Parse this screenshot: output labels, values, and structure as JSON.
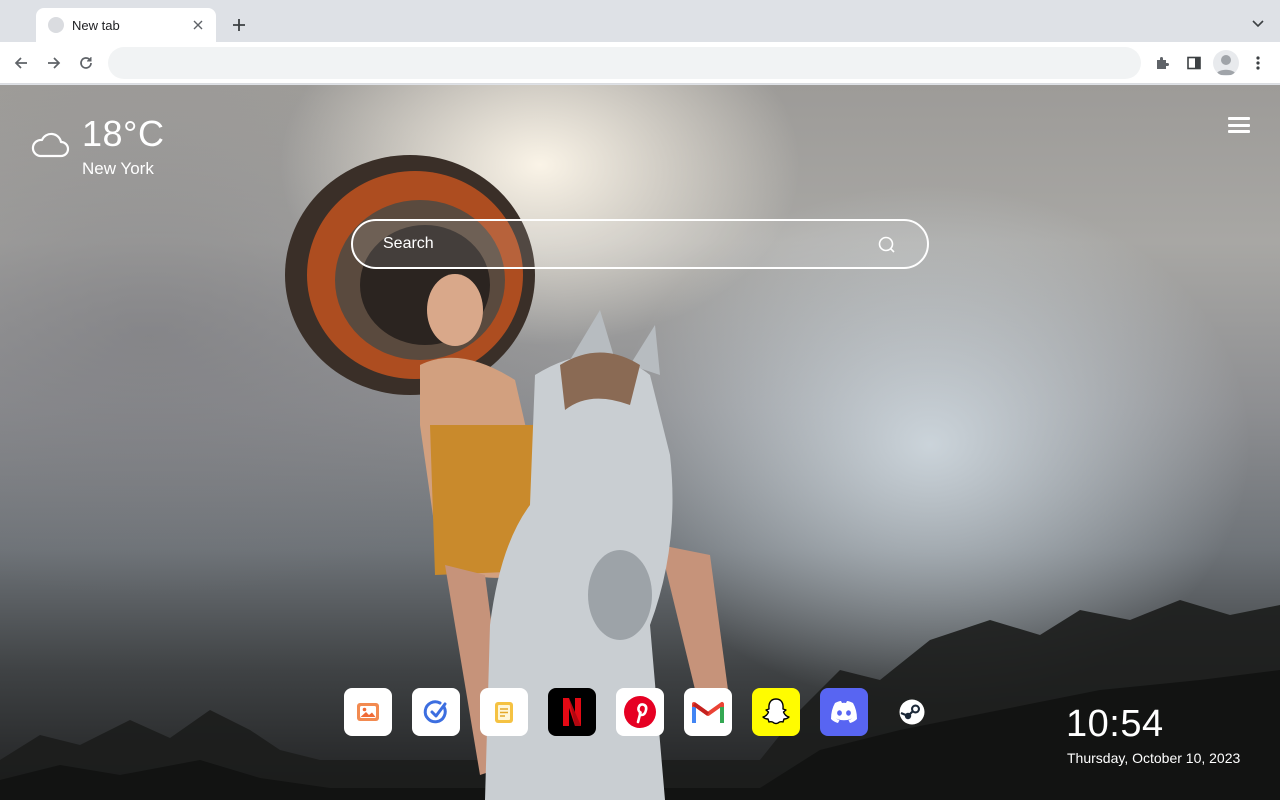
{
  "browser": {
    "tab_title": "New tab",
    "omnibox_value": "",
    "icons": [
      "tab-favicon-icon",
      "close-icon",
      "plus-icon",
      "chevron-down-icon",
      "back-arrow-icon",
      "forward-arrow-icon",
      "reload-icon",
      "puzzle-extension-icon",
      "side-panel-icon",
      "profile-avatar-icon",
      "kebab-menu-icon"
    ]
  },
  "weather": {
    "temperature": "18°C",
    "city": "New York",
    "icon": "cloud-icon"
  },
  "search": {
    "placeholder": "Search",
    "icon": "search-icon"
  },
  "menu": {
    "icon": "hamburger-menu-icon"
  },
  "shortcuts": [
    {
      "name": "Photos",
      "icon": "image-icon",
      "bg": "#ffffff",
      "accent": "#f06a35"
    },
    {
      "name": "Todo",
      "icon": "check-circle-icon",
      "bg": "#ffffff",
      "accent": "#3c6ee0"
    },
    {
      "name": "Notes",
      "icon": "note-icon",
      "bg": "#ffffff",
      "accent": "#f5c242"
    },
    {
      "name": "Netflix",
      "icon": "netflix-icon",
      "bg": "#000000",
      "accent": "#e50914"
    },
    {
      "name": "Pinterest",
      "icon": "pinterest-icon",
      "bg": "#ffffff",
      "accent": "#e60023"
    },
    {
      "name": "Gmail",
      "icon": "gmail-icon",
      "bg": "#ffffff",
      "accent": "#ea4335"
    },
    {
      "name": "Snapchat",
      "icon": "snapchat-icon",
      "bg": "#fffc00",
      "accent": "#ffffff"
    },
    {
      "name": "Discord",
      "icon": "discord-icon",
      "bg": "#5865f2",
      "accent": "#ffffff"
    },
    {
      "name": "Steam",
      "icon": "steam-icon",
      "bg": "transparent",
      "accent": "#ffffff"
    }
  ],
  "clock": {
    "time": "10:54",
    "date": "Thursday, October 10, 2023"
  }
}
